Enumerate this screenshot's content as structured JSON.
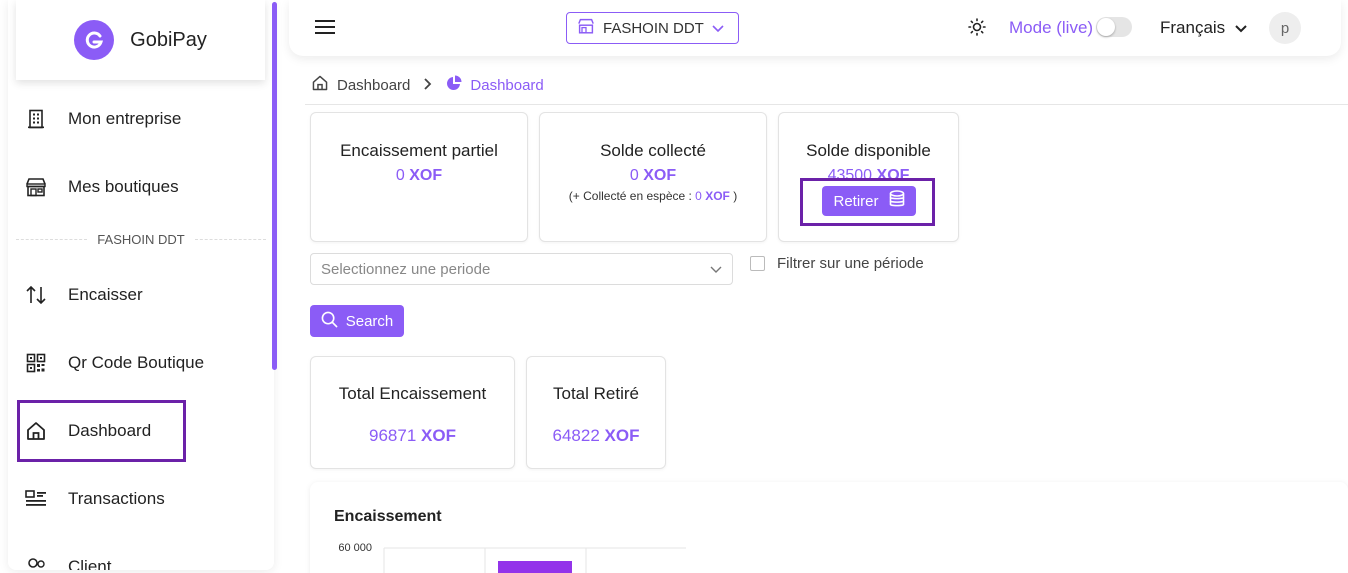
{
  "brand": {
    "name": "GobiPay"
  },
  "sidebar": {
    "items": [
      {
        "label": "Mon entreprise"
      },
      {
        "label": "Mes boutiques"
      },
      {
        "label": "Encaisser"
      },
      {
        "label": "Qr Code Boutique"
      },
      {
        "label": "Dashboard"
      },
      {
        "label": "Transactions"
      },
      {
        "label": "Client"
      }
    ],
    "section_label": "FASHOIN DDT"
  },
  "topbar": {
    "shop": "FASHOIN DDT",
    "mode_label": "Mode (live)",
    "language": "Français",
    "avatar_letter": "p"
  },
  "breadcrumb": {
    "home": "Dashboard",
    "current": "Dashboard"
  },
  "cards": {
    "partiel": {
      "title": "Encaissement partiel",
      "value": "0",
      "currency": "XOF"
    },
    "collecte": {
      "title": "Solde collecté",
      "value": "0",
      "currency": "XOF",
      "note_prefix": "(+ Collecté en espèce : ",
      "note_value": "0",
      "note_currency": "XOF",
      "note_suffix": " )"
    },
    "disponible": {
      "title": "Solde disponible",
      "value": "43500",
      "currency": "XOF",
      "button": "Retirer"
    }
  },
  "filters": {
    "period_placeholder": "Selectionnez une periode",
    "filter_label": "Filtrer sur une période",
    "search_label": "Search"
  },
  "totals": {
    "encaissement": {
      "title": "Total Encaissement",
      "value": "96871",
      "currency": "XOF"
    },
    "retire": {
      "title": "Total Retiré",
      "value": "64822",
      "currency": "XOF"
    }
  },
  "chart_data": {
    "type": "bar",
    "title": "Encaissement",
    "yticks": [
      "60 000"
    ],
    "ylim": [
      0,
      60000
    ],
    "bar_color": "#9333ea"
  },
  "colors": {
    "accent": "#8b5cf6",
    "highlight": "#6b21a8"
  }
}
